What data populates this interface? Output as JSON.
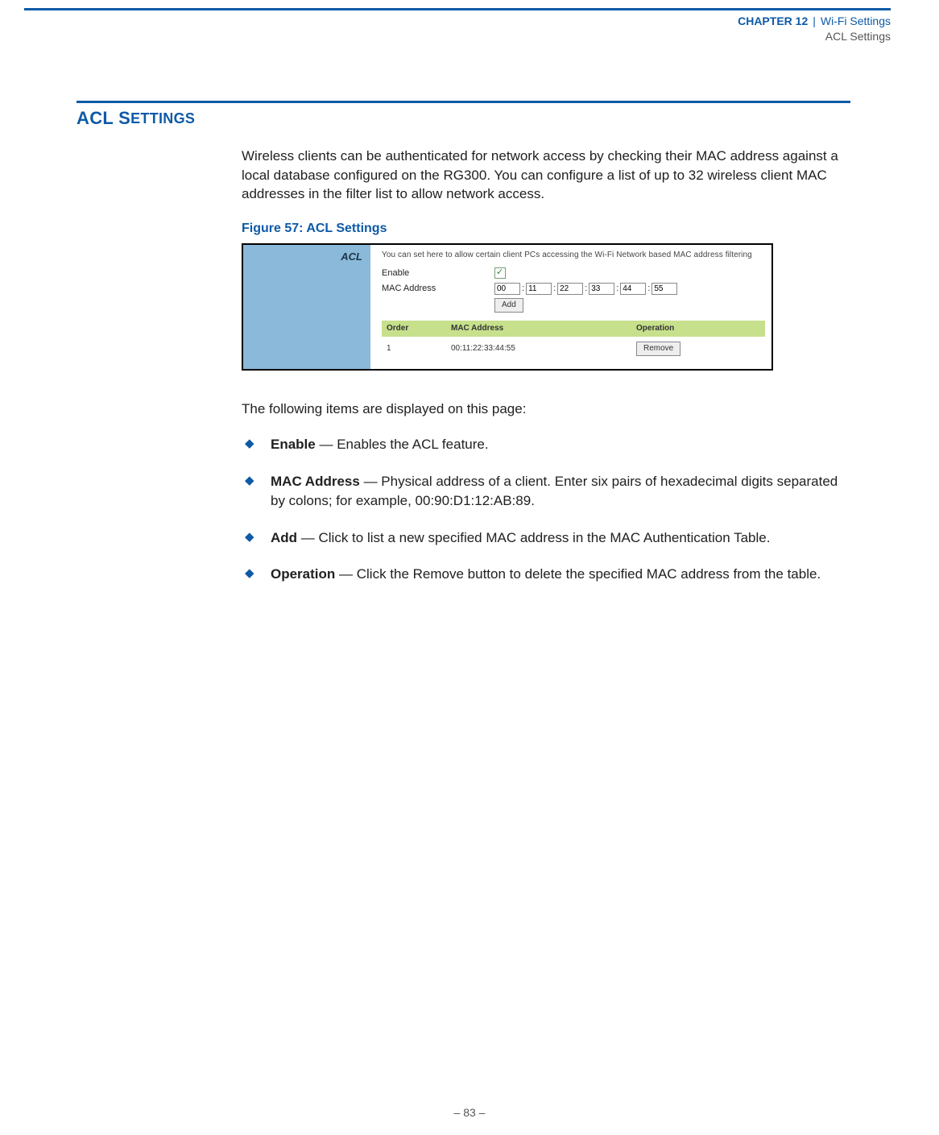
{
  "running_head": {
    "chapter_label": "CHAPTER 12",
    "section": "Wi-Fi Settings",
    "subline": "ACL Settings"
  },
  "heading": {
    "prefix": "ACL S",
    "rest": "ETTINGS"
  },
  "intro": "Wireless clients can be authenticated for network access by checking their MAC address against a local database configured on the RG300. You can configure a list of up to 32 wireless client MAC addresses in the filter list to allow network access.",
  "figure_caption": "Figure 57:  ACL Settings",
  "figure": {
    "sidebar_title": "ACL",
    "description": "You can set here to allow certain client PCs accessing the Wi-Fi Network based MAC address filtering",
    "enable_label": "Enable",
    "mac_label": "MAC Address",
    "mac_parts": [
      "00",
      "11",
      "22",
      "33",
      "44",
      "55"
    ],
    "add_button": "Add",
    "table": {
      "headers": {
        "order": "Order",
        "mac": "MAC Address",
        "operation": "Operation"
      },
      "row": {
        "order": "1",
        "mac": "00:11:22:33:44:55",
        "remove_button": "Remove"
      }
    }
  },
  "followup": "The following items are displayed on this page:",
  "items": [
    {
      "term": "Enable",
      "desc": " — Enables the ACL feature."
    },
    {
      "term": "MAC Address",
      "desc": " — Physical address of a client. Enter six pairs of hexadecimal digits separated by colons; for example, 00:90:D1:12:AB:89."
    },
    {
      "term": "Add",
      "desc": " — Click to list a new specified MAC address in the MAC Authentication Table."
    },
    {
      "term": "Operation",
      "desc": " — Click the Remove button to delete the specified MAC address from the table."
    }
  ],
  "page_number": "–  83  –"
}
